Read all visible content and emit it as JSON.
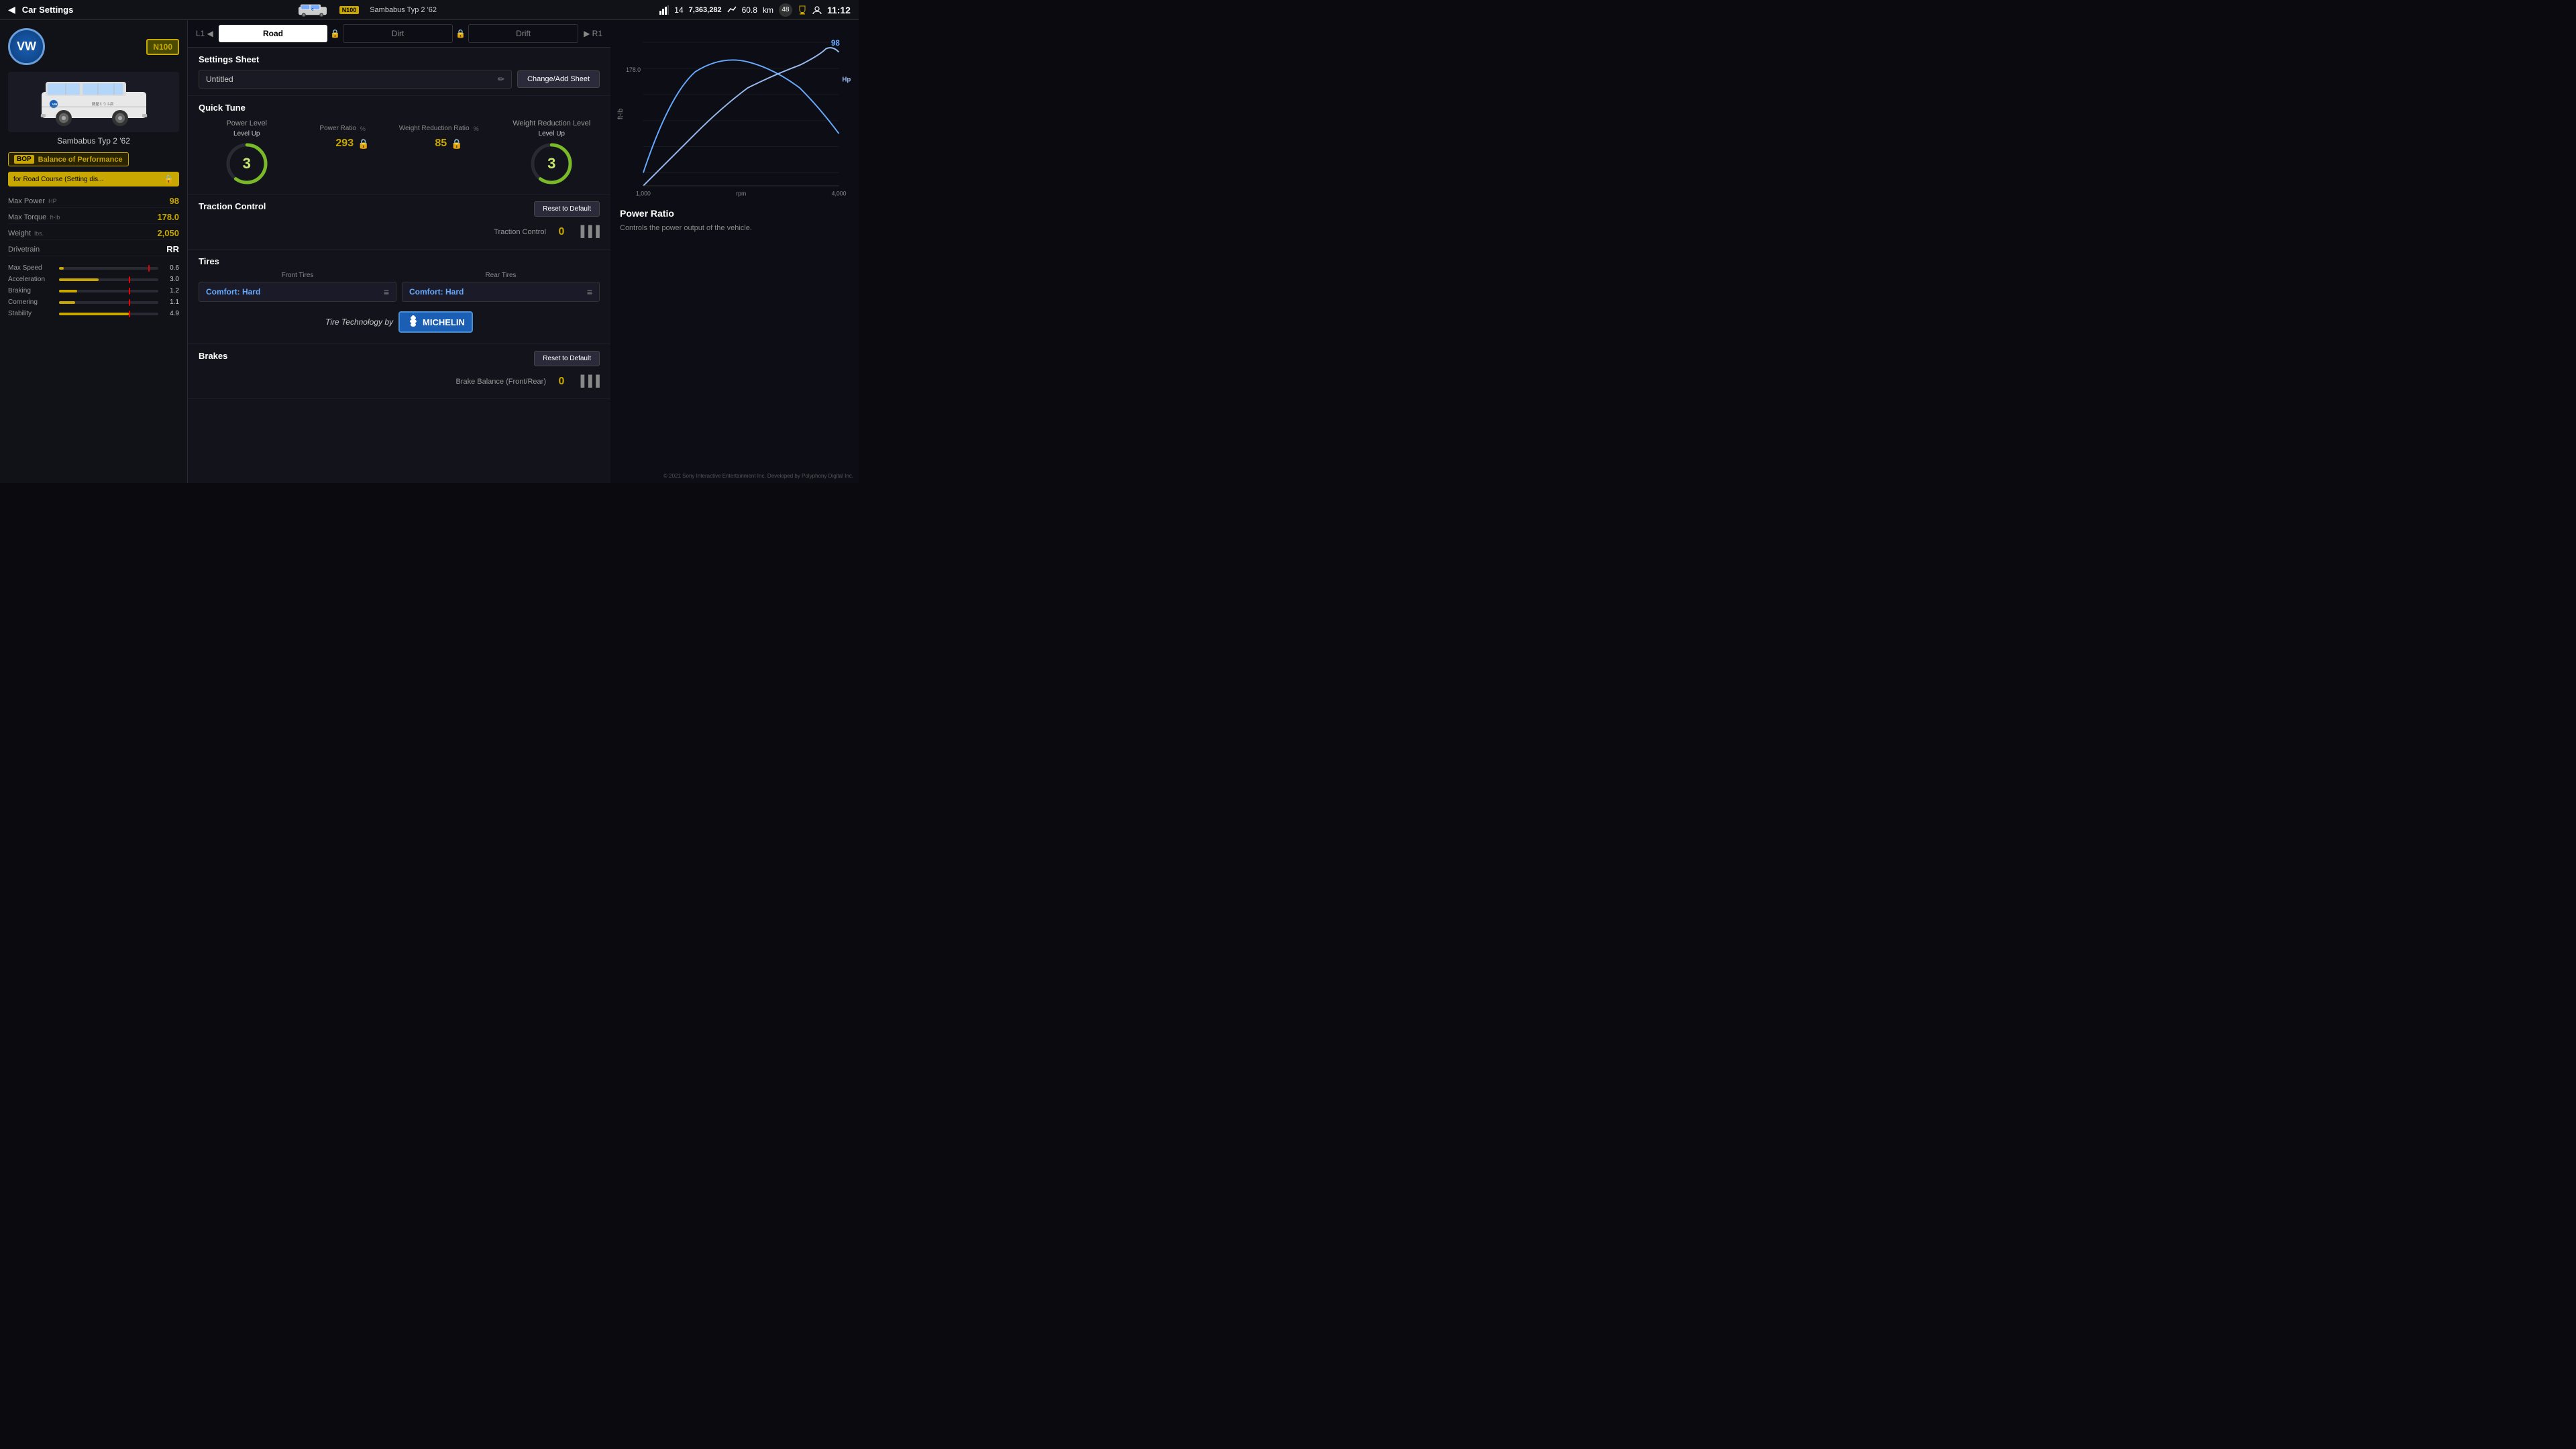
{
  "topbar": {
    "back_label": "◀",
    "title": "Car Settings",
    "car_icon_alt": "VW Bus",
    "rating_label": "N100",
    "car_name": "Sambabus Typ 2 '62",
    "signal_icon": "signal",
    "level": "14",
    "time": "11:12",
    "credits": "7,363,282",
    "km": "60.8",
    "km_unit": "km",
    "level_badge": "48"
  },
  "left": {
    "vw_logo": "VW",
    "n100_badge": "N100",
    "car_name": "Sambabus Typ 2 '62",
    "bop_label": "BOP",
    "bop_text": "Balance of Performance",
    "bop_course": "for Road Course (Setting dis...",
    "max_power_label": "Max Power",
    "max_power_unit": "HP",
    "max_power_val": "98",
    "max_torque_label": "Max Torque",
    "max_torque_unit": "ft-lb",
    "max_torque_val": "178.0",
    "weight_label": "Weight",
    "weight_unit": "lbs.",
    "weight_val": "2,050",
    "drivetrain_label": "Drivetrain",
    "drivetrain_val": "RR",
    "perf_bars": [
      {
        "name": "Max Speed",
        "fill": 5,
        "marker": 90,
        "val": "0.6"
      },
      {
        "name": "Acceleration",
        "fill": 40,
        "marker": 70,
        "val": "3.0"
      },
      {
        "name": "Braking",
        "fill": 18,
        "marker": 70,
        "val": "1.2"
      },
      {
        "name": "Cornering",
        "fill": 16,
        "marker": 70,
        "val": "1.1"
      },
      {
        "name": "Stability",
        "fill": 70,
        "marker": 70,
        "val": "4.9"
      }
    ]
  },
  "tabs": {
    "prev_label": "L1 ◀",
    "next_label": "▶ R1",
    "items": [
      {
        "label": "Road",
        "active": true,
        "locked": false
      },
      {
        "label": "Dirt",
        "active": false,
        "locked": true
      },
      {
        "label": "Drift",
        "active": false,
        "locked": true
      }
    ]
  },
  "settings_sheet": {
    "section_title": "Settings Sheet",
    "sheet_name": "Untitled",
    "edit_icon": "✏",
    "change_btn": "Change/Add Sheet"
  },
  "quick_tune": {
    "section_title": "Quick Tune",
    "power_level_label": "Power Level",
    "power_level_up": "Level Up",
    "power_level_val": "3",
    "weight_level_label": "Weight Reduction Level",
    "weight_level_up": "Level Up",
    "weight_level_val": "3",
    "power_ratio_label": "Power Ratio",
    "power_ratio_unit": "%",
    "power_ratio_val": "293",
    "weight_ratio_label": "Weight Reduction Ratio",
    "weight_ratio_unit": "%",
    "weight_ratio_val": "85"
  },
  "traction": {
    "section_title": "Traction Control",
    "reset_btn": "Reset to Default",
    "control_label": "Traction Control",
    "control_val": "0"
  },
  "tires": {
    "section_title": "Tires",
    "front_label": "Front Tires",
    "rear_label": "Rear Tires",
    "front_tire": "Comfort: Hard",
    "rear_tire": "Comfort: Hard",
    "michelin_text": "Tire Technology by",
    "michelin_logo": "MICHELIN"
  },
  "brakes": {
    "section_title": "Brakes",
    "reset_btn": "Reset to Default",
    "balance_label": "Brake Balance (Front/Rear)",
    "balance_val": "0"
  },
  "chart": {
    "y_label": "ft-lb",
    "max_val": "98",
    "hp_label": "Hp",
    "y_axis_val": "178.0",
    "x_labels": [
      "1,000",
      "4,000"
    ],
    "x_unit": "rpm"
  },
  "power_ratio": {
    "title": "Power Ratio",
    "description": "Controls the power output of the vehicle."
  },
  "copyright": "© 2021 Sony Interactive Entertainment Inc. Developed by Polyphony Digital Inc."
}
